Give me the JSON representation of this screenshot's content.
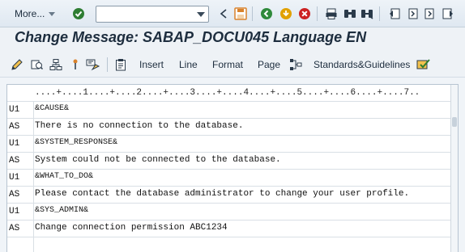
{
  "system_toolbar": {
    "more_label": "More...",
    "command_field_value": "",
    "icons": [
      "check-icon",
      "back-icon",
      "save-icon",
      "back-nav-icon",
      "exit-icon",
      "cancel-icon",
      "print-icon",
      "find-icon",
      "find-next-icon",
      "first-page-icon",
      "prev-page-icon",
      "next-page-icon",
      "last-page-icon"
    ]
  },
  "title": "Change Message: SABAP_DOCU045 Language EN",
  "app_toolbar": {
    "icons": [
      "pencil-icon",
      "display-change-icon",
      "hierarchy-icon",
      "pin-icon",
      "settings-icon",
      "clipboard-icon",
      "format-tree-icon",
      "check-doc-icon"
    ],
    "menus": [
      "Insert",
      "Line",
      "Format",
      "Page",
      "Standards&Guidelines"
    ]
  },
  "editor": {
    "ruler": "....+....1....+....2....+....3....+....4....+....5....+....6....+....7..",
    "lines": [
      {
        "format": "U1",
        "text": "&CAUSE&"
      },
      {
        "format": "AS",
        "text": "There is no connection to the database."
      },
      {
        "format": "U1",
        "text": "&SYSTEM_RESPONSE&"
      },
      {
        "format": "AS",
        "text": "System could not be connected to the database."
      },
      {
        "format": "U1",
        "text": "&WHAT_TO_DO&"
      },
      {
        "format": "AS",
        "text": "Please contact the database administrator to change your user profile."
      },
      {
        "format": "U1",
        "text": "&SYS_ADMIN&"
      },
      {
        "format": "AS",
        "text": "Change connection permission ABC1234"
      },
      {
        "format": "",
        "text": ""
      }
    ]
  },
  "colors": {
    "toolbar_bg": "#dfe8f1",
    "title_text": "#1d2d3e",
    "check_green": "#2e7d32",
    "save_orange": "#d9822b",
    "nav_green": "#2f8a3b",
    "exit_yellow": "#e1a100",
    "cancel_red": "#cc2222"
  }
}
